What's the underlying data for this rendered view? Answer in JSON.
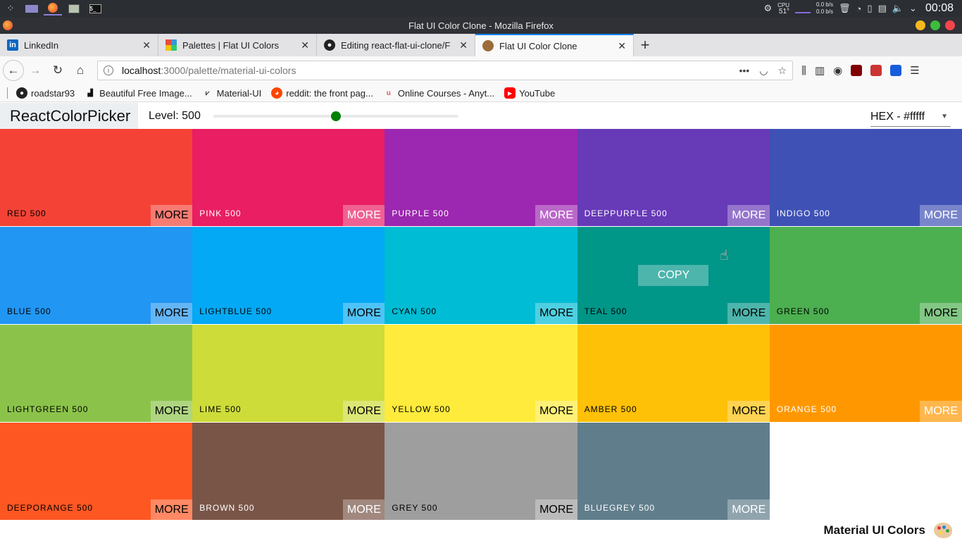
{
  "taskbar": {
    "cpu_label": "CPU",
    "cpu_temp": "51°",
    "net_down": "0.0 b/s",
    "net_up": "0.0 b/s",
    "time": "00:08"
  },
  "window": {
    "title": "Flat UI Color Clone - Mozilla Firefox"
  },
  "tabs": [
    {
      "label": "LinkedIn",
      "icon": "linkedin-icon"
    },
    {
      "label": "Palettes | Flat UI Colors",
      "icon": "flatui-icon"
    },
    {
      "label": "Editing react-flat-ui-clone/F",
      "icon": "github-icon"
    },
    {
      "label": "Flat UI Color Clone",
      "icon": "react-icon",
      "active": true
    }
  ],
  "url": {
    "host": "localhost",
    "path": ":3000/palette/material-ui-colors"
  },
  "bookmarks": [
    {
      "label": "roadstar93",
      "icon": "github-icon"
    },
    {
      "label": "Beautiful Free Image...",
      "icon": "unsplash-icon"
    },
    {
      "label": "Material-UI",
      "icon": "materialui-icon"
    },
    {
      "label": "reddit: the front pag...",
      "icon": "reddit-icon"
    },
    {
      "label": "Online Courses - Anyt...",
      "icon": "udemy-icon"
    },
    {
      "label": "YouTube",
      "icon": "youtube-icon"
    }
  ],
  "app": {
    "logo": "ReactColorPicker",
    "level_label": "Level: 500",
    "level_value": 500,
    "level_min": 100,
    "level_max": 900,
    "format": "HEX - #fffff"
  },
  "palette": {
    "more_label": "MORE",
    "copy_label": "COPY",
    "colors": [
      {
        "name": "RED 500",
        "hex": "#f44336",
        "text": "#000"
      },
      {
        "name": "PINK 500",
        "hex": "#e91e63",
        "text": "#fff"
      },
      {
        "name": "PURPLE 500",
        "hex": "#9c27b0",
        "text": "#fff"
      },
      {
        "name": "DEEPPURPLE 500",
        "hex": "#673ab7",
        "text": "#fff"
      },
      {
        "name": "INDIGO 500",
        "hex": "#3f51b5",
        "text": "#fff"
      },
      {
        "name": "BLUE 500",
        "hex": "#2196f3",
        "text": "#000"
      },
      {
        "name": "LIGHTBLUE 500",
        "hex": "#03a9f4",
        "text": "#000"
      },
      {
        "name": "CYAN 500",
        "hex": "#00bcd4",
        "text": "#000"
      },
      {
        "name": "TEAL 500",
        "hex": "#009688",
        "text": "#000",
        "hover": true
      },
      {
        "name": "GREEN 500",
        "hex": "#4caf50",
        "text": "#000"
      },
      {
        "name": "LIGHTGREEN 500",
        "hex": "#8bc34a",
        "text": "#000"
      },
      {
        "name": "LIME 500",
        "hex": "#cddc39",
        "text": "#000"
      },
      {
        "name": "YELLOW 500",
        "hex": "#ffeb3b",
        "text": "#000"
      },
      {
        "name": "AMBER 500",
        "hex": "#ffc107",
        "text": "#000"
      },
      {
        "name": "ORANGE 500",
        "hex": "#ff9800",
        "text": "#fff"
      },
      {
        "name": "DEEPORANGE 500",
        "hex": "#ff5722",
        "text": "#000"
      },
      {
        "name": "BROWN 500",
        "hex": "#795548",
        "text": "#fff"
      },
      {
        "name": "GREY 500",
        "hex": "#9e9e9e",
        "text": "#000"
      },
      {
        "name": "BLUEGREY 500",
        "hex": "#607d8b",
        "text": "#fff"
      }
    ]
  },
  "footer": {
    "palette_name": "Material UI Colors",
    "emoji": "palette-emoji"
  }
}
